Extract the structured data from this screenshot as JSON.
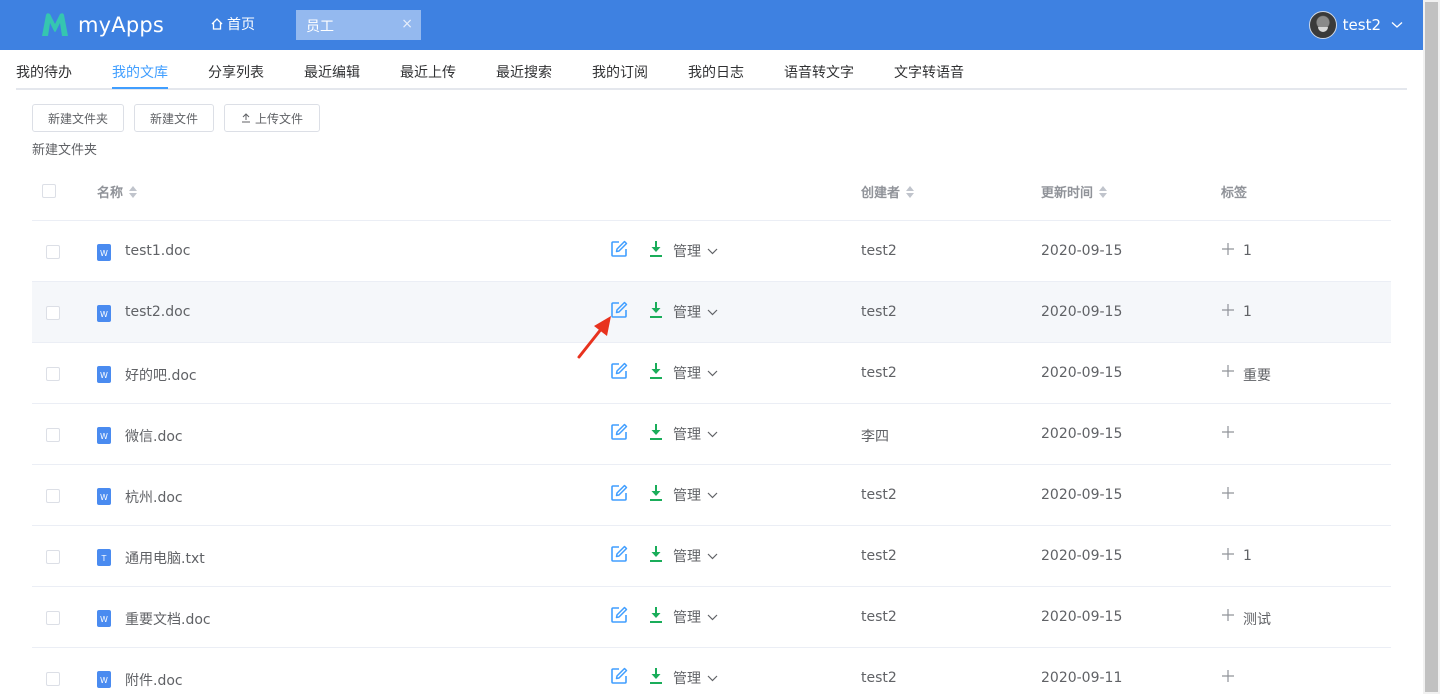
{
  "header": {
    "app_name": "myApps",
    "home_label": "首页",
    "active_tab_label": "员工",
    "close_symbol": "×",
    "username": "test2",
    "brand_color": "#3e81e1",
    "logo_color": "#35c6b0"
  },
  "nav": {
    "items": [
      {
        "label": "我的待办",
        "active": false
      },
      {
        "label": "我的文库",
        "active": true
      },
      {
        "label": "分享列表",
        "active": false
      },
      {
        "label": "最近编辑",
        "active": false
      },
      {
        "label": "最近上传",
        "active": false
      },
      {
        "label": "最近搜索",
        "active": false
      },
      {
        "label": "我的订阅",
        "active": false
      },
      {
        "label": "我的日志",
        "active": false
      },
      {
        "label": "语音转文字",
        "active": false
      },
      {
        "label": "文字转语音",
        "active": false
      }
    ],
    "accent_color": "#409eff"
  },
  "toolbar": {
    "new_folder_label": "新建文件夹",
    "new_file_label": "新建文件",
    "upload_label": "上传文件"
  },
  "breadcrumb": {
    "current": "新建文件夹"
  },
  "table": {
    "columns": {
      "name": "名称",
      "creator": "创建者",
      "updated": "更新时间",
      "tags": "标签"
    },
    "manage_label": "管理",
    "rows": [
      {
        "name": "test1.doc",
        "type": "W",
        "creator": "test2",
        "updated": "2020-09-15",
        "tag": "1"
      },
      {
        "name": "test2.doc",
        "type": "W",
        "creator": "test2",
        "updated": "2020-09-15",
        "tag": "1",
        "highlighted": true
      },
      {
        "name": "好的吧.doc",
        "type": "W",
        "creator": "test2",
        "updated": "2020-09-15",
        "tag": "重要"
      },
      {
        "name": "微信.doc",
        "type": "W",
        "creator": "李四",
        "updated": "2020-09-15",
        "tag": ""
      },
      {
        "name": "杭州.doc",
        "type": "W",
        "creator": "test2",
        "updated": "2020-09-15",
        "tag": ""
      },
      {
        "name": "通用电脑.txt",
        "type": "T",
        "creator": "test2",
        "updated": "2020-09-15",
        "tag": "1"
      },
      {
        "name": "重要文档.doc",
        "type": "W",
        "creator": "test2",
        "updated": "2020-09-15",
        "tag": "测试"
      },
      {
        "name": "附件.doc",
        "type": "W",
        "creator": "test2",
        "updated": "2020-09-11",
        "tag": ""
      }
    ],
    "icon_colors": {
      "edit": "#409eff",
      "download": "#1aad5a",
      "file": "#4a8bf0"
    }
  },
  "annotation": {
    "arrow_color": "#e8321e"
  }
}
